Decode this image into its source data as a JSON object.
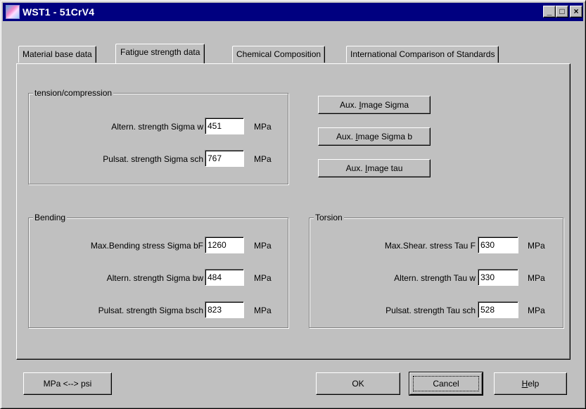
{
  "window": {
    "title": "WST1 - 51CrV4",
    "controls": {
      "minimize": "_",
      "maximize": "□",
      "close": "×"
    }
  },
  "tabs": [
    {
      "label": "Material base data",
      "active": false
    },
    {
      "label": "Fatigue strength data",
      "active": true
    },
    {
      "label": "Chemical Composition",
      "active": false
    },
    {
      "label": "International Comparison of Standards",
      "active": false
    }
  ],
  "tension": {
    "legend": "tension/compression",
    "fields": [
      {
        "label": "Altern. strength  Sigma w",
        "value": "451",
        "unit": "MPa"
      },
      {
        "label": "Pulsat. strength  Sigma sch",
        "value": "767",
        "unit": "MPa"
      }
    ]
  },
  "aux_buttons": [
    {
      "prefix": "Aux. ",
      "accel": "I",
      "suffix": "mage Sigma"
    },
    {
      "prefix": "Aux. ",
      "accel": "I",
      "suffix": "mage Sigma b"
    },
    {
      "prefix": "Aux. ",
      "accel": "I",
      "suffix": "mage tau"
    }
  ],
  "bending": {
    "legend": "Bending",
    "fields": [
      {
        "label": "Max.Bending stress  Sigma bF",
        "value": "1260",
        "unit": "MPa"
      },
      {
        "label": "Altern. strength  Sigma bw",
        "value": "484",
        "unit": "MPa"
      },
      {
        "label": "Pulsat. strength  Sigma bsch",
        "value": "823",
        "unit": "MPa"
      }
    ]
  },
  "torsion": {
    "legend": "Torsion",
    "fields": [
      {
        "label": "Max.Shear. stress  Tau F",
        "value": "630",
        "unit": "MPa"
      },
      {
        "label": "Altern. strength  Tau w",
        "value": "330",
        "unit": "MPa"
      },
      {
        "label": "Pulsat. strength  Tau sch",
        "value": "528",
        "unit": "MPa"
      }
    ]
  },
  "footer": {
    "convert_label": "MPa <--> psi",
    "ok_label": "OK",
    "cancel_label": "Cancel",
    "help_accel": "H",
    "help_rest": "elp"
  },
  "colors": {
    "titlebar": "#000080",
    "face": "#c0c0c0"
  }
}
